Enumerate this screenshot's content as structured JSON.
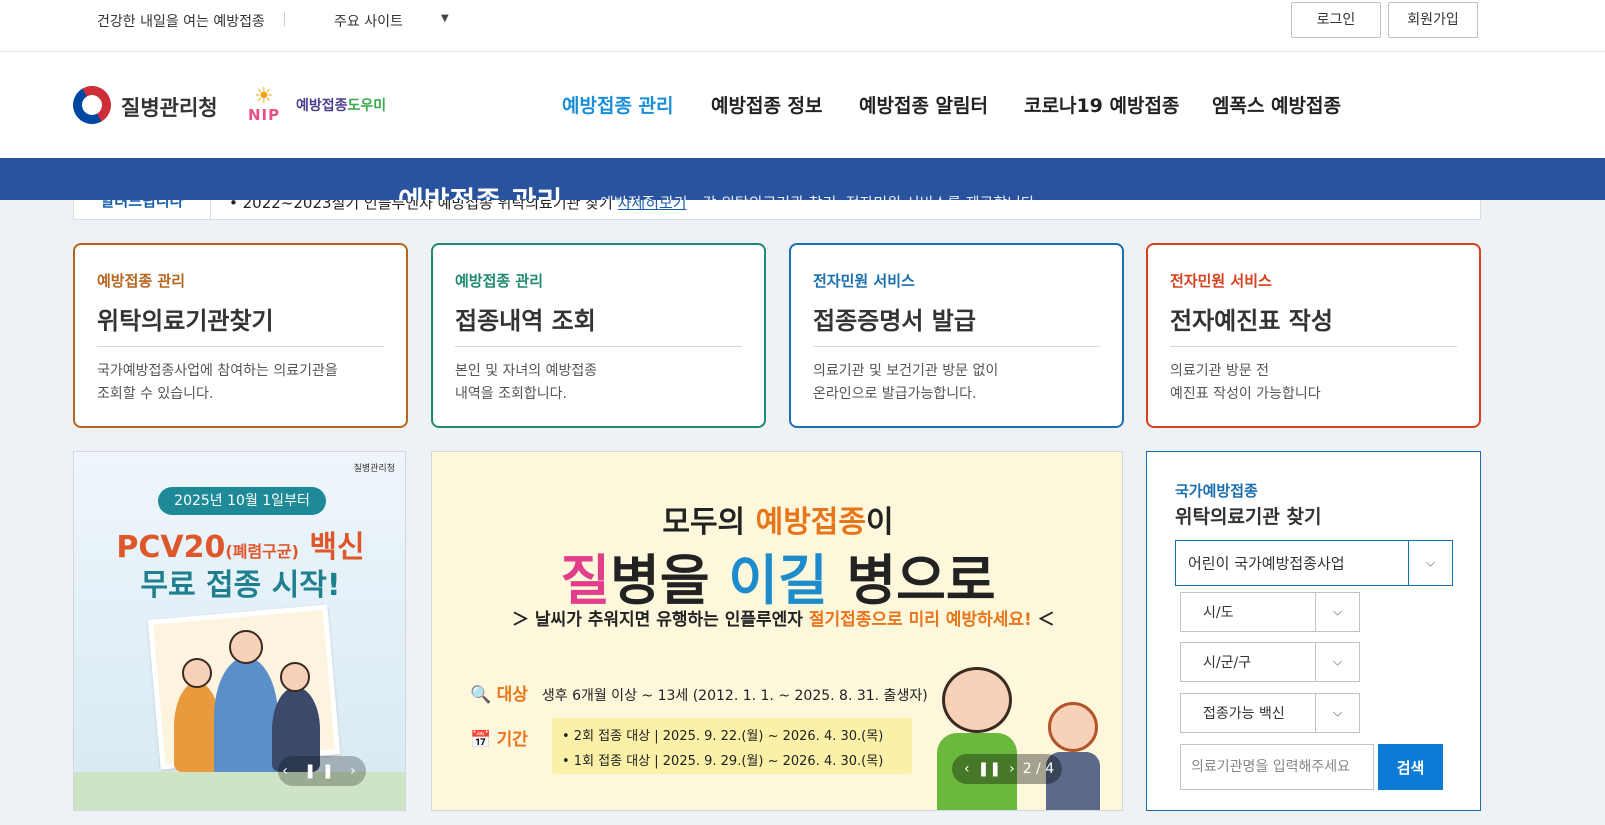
{
  "util": {
    "slogan": "건강한 내일을 여는 예방접종",
    "sites_label": "주요 사이트",
    "sites_caret": "▼",
    "login": "로그인",
    "join": "회원가입"
  },
  "logos": {
    "kdca": "질병관리청",
    "nip_badge": "NIP",
    "nip_name_a": "예방접종",
    "nip_name_b": "도우미"
  },
  "gnb": {
    "items": [
      "예방접종 관리",
      "예방접종 정보",
      "예방접종 알림터",
      "코로나19 예방접종",
      "엠폭스 예방접종"
    ],
    "active_index": 0
  },
  "sub_banner": {
    "title": "예방접종 관리",
    "overlay_text": "예방접종 관리 - 각 위탁의료기관 찾기, 전자민원 서비스를 제공합니다."
  },
  "notice": {
    "label": "알려드립니다",
    "text": "2022~2023절기 인플루엔자 예방접종 위탁의료기관 찾기",
    "link": "자세히보기"
  },
  "cards": [
    {
      "category": "예방접종 관리",
      "title": "위탁의료기관찾기",
      "desc1": "국가예방접종사업에 참여하는 의료기관을",
      "desc2": "조회할 수 있습니다."
    },
    {
      "category": "예방접종 관리",
      "title": "접종내역 조회",
      "desc1": "본인 및 자녀의 예방접종",
      "desc2": "내역을 조회합니다."
    },
    {
      "category": "전자민원 서비스",
      "title": "접종증명서 발급",
      "desc1": "의료기관 및 보건기관 방문 없이",
      "desc2": "온라인으로 발급가능합니다."
    },
    {
      "category": "전자민원 서비스",
      "title": "전자예진표 작성",
      "desc1": "의료기관 방문 전",
      "desc2": "예진표 작성이 가능합니다"
    }
  ],
  "banner_left": {
    "org": "질병관리청",
    "pill": "2025년 10월 1일부터",
    "line1_a": "PCV20",
    "line1_b": "(폐렴구균)",
    "line1_c": " 백신",
    "line2": "무료 접종 시작!",
    "ctrl": "‹ ❚❚ ›"
  },
  "banner_center": {
    "top_a": "모두의 ",
    "top_b": "예방접종",
    "top_c": "이",
    "big_a": "질",
    "big_b": "병을 ",
    "big_c": "이길",
    "big_d": " 병으로",
    "sub_a": "날씨가 추워지면 유행하는 인플루엔자 ",
    "sub_b": "절기접종으로 미리 예방하세요!",
    "target_key": "대상",
    "target_val": "생후 6개월 이상 ~ 13세 (2012. 1. 1. ~ 2025. 8. 31. 출생자)",
    "period_key": "기간",
    "period_1": "• 2회 접종 대상  |  2025. 9. 22.(월) ~ 2026. 4. 30.(목)",
    "period_2": "• 1회 접종 대상  |  2025. 9. 29.(월) ~ 2026. 4. 30.(목)",
    "ctrl_prev": "‹",
    "ctrl_pause": "❚❚",
    "ctrl_next": "›",
    "page": "2 / 4"
  },
  "search": {
    "title1": "국가예방접종",
    "title2": "위탁의료기관 찾기",
    "program": "어린이 국가예방접종사업",
    "sido": "시/도",
    "sigungu": "시/군/구",
    "vaccine": "접종가능 백신",
    "arrow": "⌵",
    "placeholder": "의료기관명을 입력해주세요",
    "button": "검색"
  },
  "colors": {
    "brand_blue": "#29539e",
    "accent_blue": "#1a8fd8",
    "search_button": "#0d7ad6"
  }
}
